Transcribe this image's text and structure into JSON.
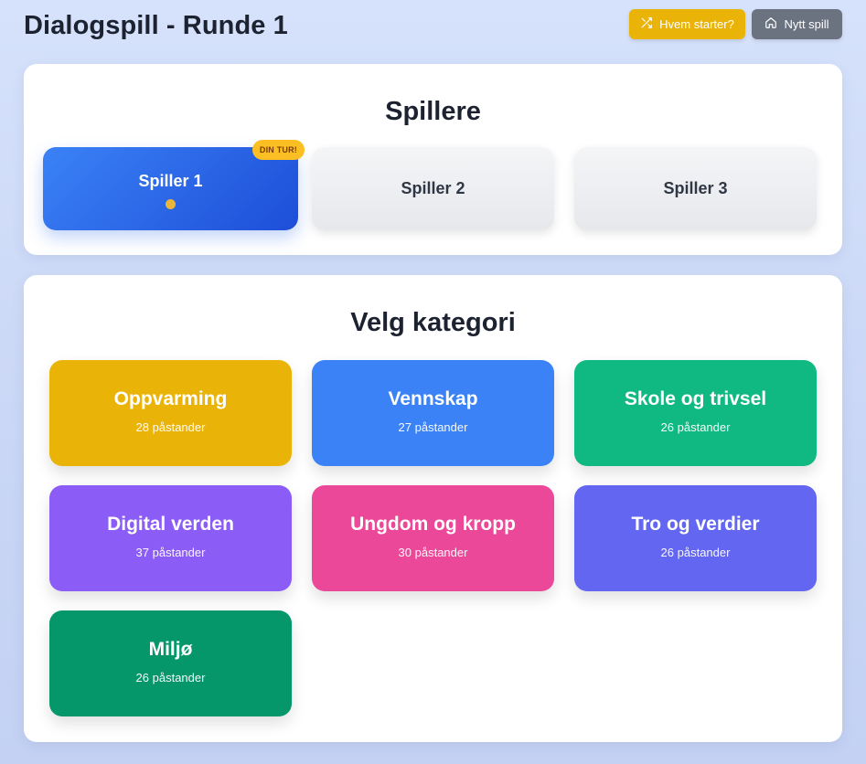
{
  "header": {
    "title": "Dialogspill - Runde 1",
    "starter_label": "Hvem starter?",
    "newgame_label": "Nytt spill"
  },
  "players": {
    "title": "Spillere",
    "turn_badge": "DIN TUR!",
    "items": [
      {
        "name": "Spiller 1",
        "active": true
      },
      {
        "name": "Spiller 2",
        "active": false
      },
      {
        "name": "Spiller 3",
        "active": false
      }
    ]
  },
  "categories": {
    "title": "Velg kategori",
    "items": [
      {
        "name": "Oppvarming",
        "count": "28 påstander",
        "color": "#eab308"
      },
      {
        "name": "Vennskap",
        "count": "27 påstander",
        "color": "#3b82f6"
      },
      {
        "name": "Skole og trivsel",
        "count": "26 påstander",
        "color": "#10b981"
      },
      {
        "name": "Digital verden",
        "count": "37 påstander",
        "color": "#8b5cf6"
      },
      {
        "name": "Ungdom og kropp",
        "count": "30 påstander",
        "color": "#ec4899"
      },
      {
        "name": "Tro og verdier",
        "count": "26 påstander",
        "color": "#6366f1"
      },
      {
        "name": "Miljø",
        "count": "26 påstander",
        "color": "#059669"
      }
    ]
  },
  "icons": {
    "starter": "shuffle-icon",
    "newgame": "home-icon",
    "turn_indicator": "dot-icon"
  }
}
